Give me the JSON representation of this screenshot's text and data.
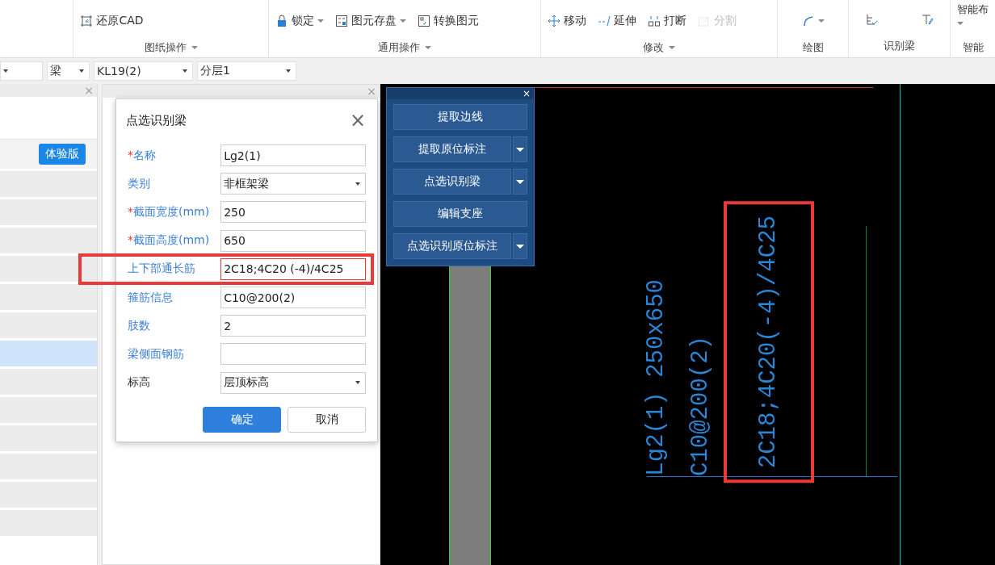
{
  "ribbon": {
    "groups": [
      {
        "label": "图纸操作",
        "expandable": true,
        "items": [
          {
            "label": "还原CAD",
            "dropdown": false,
            "disabled": false
          }
        ]
      },
      {
        "label": "通用操作",
        "expandable": true,
        "items": [
          {
            "label": "锁定",
            "dropdown": true,
            "disabled": false
          },
          {
            "label": "图元存盘",
            "dropdown": true,
            "disabled": false
          },
          {
            "label": "转换图元",
            "dropdown": false,
            "disabled": false
          }
        ]
      },
      {
        "label": "修改",
        "expandable": true,
        "items": [
          {
            "label": "移动",
            "dropdown": false,
            "disabled": false
          },
          {
            "label": "延伸",
            "dropdown": false,
            "disabled": false
          },
          {
            "label": "打断",
            "dropdown": false,
            "disabled": false
          },
          {
            "label": "分割",
            "dropdown": false,
            "disabled": true
          }
        ]
      },
      {
        "label": "绘图",
        "expandable": false,
        "items": [
          {
            "dropdown": true,
            "disabled": false
          }
        ]
      },
      {
        "label": "识别梁",
        "expandable": false,
        "items": [
          {
            "dropdown": false,
            "disabled": false
          },
          {
            "dropdown": false,
            "disabled": false
          }
        ]
      },
      {
        "label": "智能",
        "expandable": false,
        "items": [
          {
            "label": "智能布",
            "dropdown": true,
            "disabled": false
          }
        ]
      }
    ]
  },
  "toolbar": {
    "selects": [
      {
        "value": "梁"
      },
      {
        "value": "KL19(2)"
      },
      {
        "value": "分层1"
      }
    ]
  },
  "left_panel": {
    "close": "×",
    "badge": "体验版",
    "rows": [
      {
        "selected": false
      },
      {
        "selected": false
      },
      {
        "selected": false
      },
      {
        "selected": false
      },
      {
        "selected": false
      },
      {
        "selected": false
      },
      {
        "selected": true
      },
      {
        "selected": false
      },
      {
        "selected": false
      },
      {
        "selected": false
      },
      {
        "selected": false
      },
      {
        "selected": false
      },
      {
        "selected": false
      }
    ]
  },
  "middle_panel": {
    "close": "×"
  },
  "dialog": {
    "title": "点选识别梁",
    "close": "×",
    "required_mark": "*",
    "fields": [
      {
        "label": "名称",
        "required": true,
        "kind": "text",
        "value": "Lg2(1)",
        "color": "#3a7fd5",
        "highlighted": false
      },
      {
        "label": "类别",
        "required": false,
        "kind": "select",
        "value": "非框架梁",
        "color": "#3a7fd5",
        "highlighted": false
      },
      {
        "label": "截面宽度(mm)",
        "required": true,
        "kind": "text",
        "value": "250",
        "color": "#3a7fd5",
        "highlighted": false
      },
      {
        "label": "截面高度(mm)",
        "required": true,
        "kind": "text",
        "value": "650",
        "color": "#3a7fd5",
        "highlighted": false
      },
      {
        "label": "上下部通长筋",
        "required": false,
        "kind": "text",
        "value": "2C18;4C20 (-4)/4C25",
        "color": "#3a7fd5",
        "highlighted": true
      },
      {
        "label": "箍筋信息",
        "required": false,
        "kind": "text",
        "value": "C10@200(2)",
        "color": "#3a7fd5",
        "highlighted": false
      },
      {
        "label": "肢数",
        "required": false,
        "kind": "text",
        "value": "2",
        "color": "#3a7fd5",
        "highlighted": false
      },
      {
        "label": "梁侧面钢筋",
        "required": false,
        "kind": "text",
        "color": "#3a7fd5",
        "highlighted": false
      },
      {
        "label": "标高",
        "required": false,
        "kind": "select",
        "value": "层顶标高",
        "color": "#333333",
        "highlighted": false
      }
    ],
    "buttons": [
      {
        "label": "确定",
        "primary": true
      },
      {
        "label": "取消",
        "primary": false
      }
    ]
  },
  "tool_panel": {
    "close": "×",
    "buttons": [
      {
        "label": "提取边线",
        "dropdown": false
      },
      {
        "label": "提取原位标注",
        "dropdown": true
      },
      {
        "label": "点选识别梁",
        "dropdown": true
      },
      {
        "label": "编辑支座",
        "dropdown": false
      },
      {
        "label": "点选识别原位标注",
        "dropdown": true
      }
    ]
  },
  "canvas": {
    "annotations": [
      {
        "text": "Lg2(1) 250x650",
        "highlighted": false
      },
      {
        "text": "C10@200(2)",
        "highlighted": false
      },
      {
        "text": "2C18;4C20(-4)/4C25",
        "highlighted": true
      }
    ]
  }
}
